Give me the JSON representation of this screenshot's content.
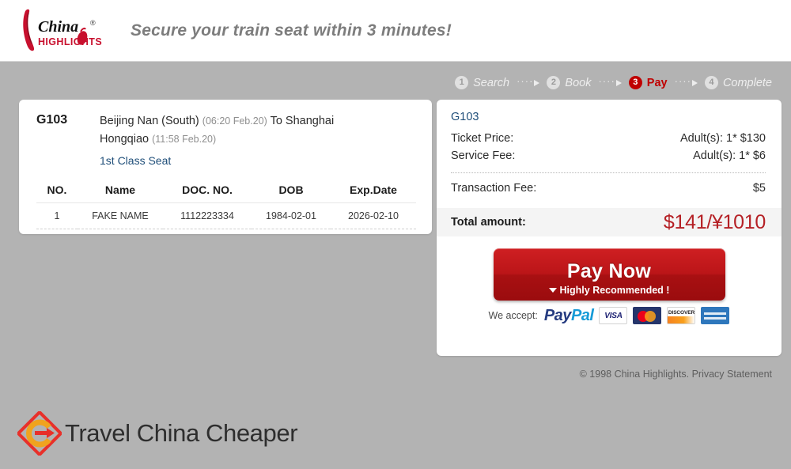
{
  "header": {
    "logo_alt": "China Highlights",
    "logo_word_top": "China",
    "logo_word_bottom": "HIGHLIGHTS",
    "logo_reg": "®",
    "tagline": "Secure your train seat within 3 minutes!"
  },
  "steps": [
    {
      "num": "1",
      "label": "Search",
      "active": false
    },
    {
      "num": "2",
      "label": "Book",
      "active": false
    },
    {
      "num": "3",
      "label": "Pay",
      "active": true
    },
    {
      "num": "4",
      "label": "Complete",
      "active": false
    }
  ],
  "step_separator": {
    "dots": "····",
    "arrow": "→"
  },
  "trip": {
    "train_code": "G103",
    "from_station": "Beijing Nan (South)",
    "from_time": "(06:20 Feb.20)",
    "to_prefix": "To Shanghai",
    "to_station": "Hongqiao",
    "to_time": "(11:58 Feb.20)",
    "seat_class": "1st Class Seat"
  },
  "passenger_table": {
    "columns": [
      "NO.",
      "Name",
      "DOC. NO.",
      "DOB",
      "Exp.Date"
    ],
    "rows": [
      [
        "1",
        "FAKE NAME",
        "1112223334",
        "1984-02-01",
        "2026-02-10"
      ]
    ]
  },
  "price": {
    "train_code": "G103",
    "lines": [
      {
        "label": "Ticket Price:",
        "value": "Adult(s): 1* $130"
      },
      {
        "label": "Service Fee:",
        "value": "Adult(s): 1* $6"
      }
    ],
    "transaction": {
      "label": "Transaction Fee:",
      "value": "$5"
    },
    "total": {
      "label": "Total amount:",
      "value": "$141/¥1010"
    },
    "total_color": "#b52025"
  },
  "pay_button": {
    "main_label": "Pay Now",
    "sub_label": "Highly  Recommended !",
    "caret_icon": "caret-down-icon",
    "color": "#bb1518"
  },
  "accept": {
    "label": "We accept:",
    "methods": [
      {
        "name": "paypal",
        "text_a": "Pay",
        "text_b": "Pal"
      },
      {
        "name": "visa",
        "text": "VISA"
      },
      {
        "name": "mastercard",
        "text": ""
      },
      {
        "name": "discover",
        "text": "DISCOVER"
      },
      {
        "name": "amex",
        "text": ""
      }
    ]
  },
  "footer": {
    "copyright": "© 1998 China Highlights.",
    "privacy_link": "Privacy Statement"
  },
  "brand": {
    "name": "Travel China Cheaper",
    "mark_icon": "travel-china-cheaper-logo"
  }
}
